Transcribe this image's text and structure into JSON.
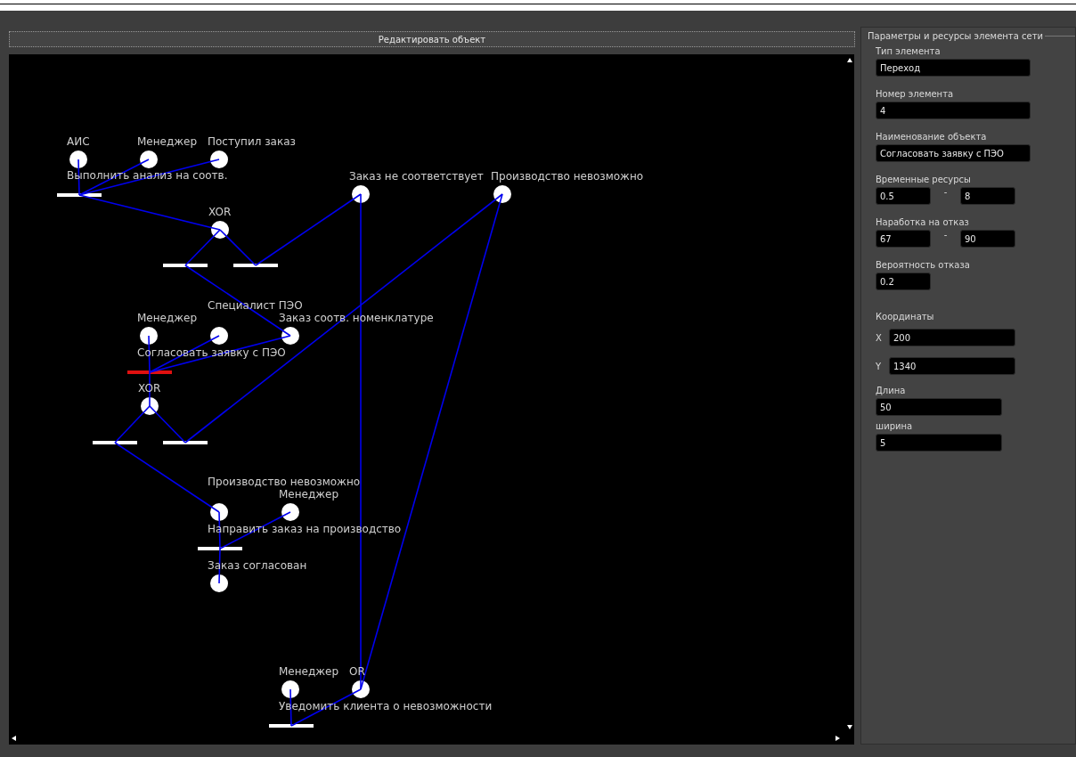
{
  "editor": {
    "edit_button": "Редактировать объект"
  },
  "net": {
    "places": [
      {
        "label": "АИС"
      },
      {
        "label": "Менеджер"
      },
      {
        "label": "Поступил заказ"
      },
      {
        "label": "Заказ не соответствует"
      },
      {
        "label": "Производство невозможно"
      },
      {
        "label": "XOR"
      },
      {
        "label": "Менеджер"
      },
      {
        "label": "Специалист ПЭО"
      },
      {
        "label": "Заказ соотв. номенклатуре"
      },
      {
        "label": "XOR"
      },
      {
        "label": "Производство невозможно"
      },
      {
        "label": "Менеджер"
      },
      {
        "label": "Заказ согласован"
      },
      {
        "label": "Менеджер"
      },
      {
        "label": "OR"
      }
    ],
    "transitions": [
      {
        "label": "Выполнить анализ на соотв.",
        "selected": false
      },
      {
        "selected": false
      },
      {
        "selected": false
      },
      {
        "label": "Согласовать заявку с ПЭО",
        "selected": true
      },
      {
        "selected": false
      },
      {
        "selected": false
      },
      {
        "label": "Направить заказ на производство",
        "selected": false
      },
      {
        "label": "Уведомить клиента о невозможности",
        "selected": false
      }
    ]
  },
  "panel": {
    "title": "Параметры и ресурсы элемента сети",
    "fields": [
      {
        "kind": "single",
        "label": "Тип элемента",
        "value": "Переход"
      },
      {
        "kind": "single",
        "label": "Номер элемента",
        "value": "4"
      },
      {
        "kind": "single",
        "label": "Наименование объекта",
        "value": "Согласовать заявку с ПЭО"
      },
      {
        "kind": "range",
        "label": "Временные ресурсы",
        "from": "0.5",
        "separator": "-",
        "to": "8"
      },
      {
        "kind": "range",
        "label": "Наработка на отказ",
        "from": "67",
        "separator": "-",
        "to": "90"
      },
      {
        "kind": "short",
        "label": "Вероятность отказа",
        "value": "0.2"
      },
      {
        "kind": "heading",
        "label": "Координаты"
      },
      {
        "kind": "axis",
        "label": "X",
        "value": "200"
      },
      {
        "kind": "axis",
        "label": "Y",
        "value": "1340"
      },
      {
        "kind": "medium",
        "label": "Длина",
        "value": "50"
      },
      {
        "kind": "medium",
        "label": "ширина",
        "value": "5"
      }
    ]
  }
}
